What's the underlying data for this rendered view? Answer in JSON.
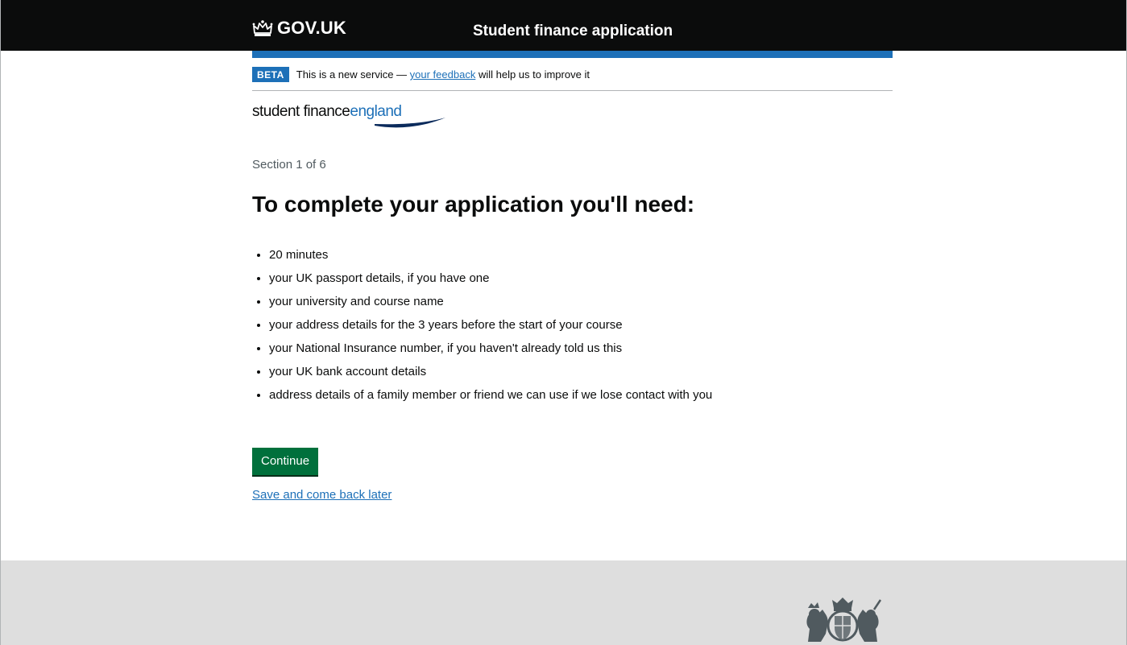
{
  "header": {
    "logo_text": "GOV.UK",
    "logo_icon": "crown-icon",
    "service_name": "Student finance application"
  },
  "phase_banner": {
    "tag": "BETA",
    "text_before": "This is a new service — ",
    "link_text": "your feedback",
    "text_after": " will help us to improve it"
  },
  "brand": {
    "word1": "student finance",
    "word2": "england",
    "swoosh_icon": "swoosh-icon"
  },
  "main": {
    "caption": "Section 1 of 6",
    "heading": "To complete your application you'll need:",
    "items": [
      "20 minutes",
      "your UK passport details, if you have one",
      "your university and course name",
      "your address details for the 3 years before the start of your course",
      "your National Insurance number, if you haven't already told us this",
      "your UK bank account details",
      "address details of a family member or friend we can use if we lose contact with you"
    ],
    "continue_label": "Continue",
    "save_link": "Save and come back later"
  },
  "footer": {
    "crest_icon": "royal-coat-of-arms-icon"
  },
  "colors": {
    "header_bg": "#0b0c0c",
    "accent_blue": "#1d70b8",
    "button_green": "#00703c",
    "footer_bg": "#dedede"
  }
}
